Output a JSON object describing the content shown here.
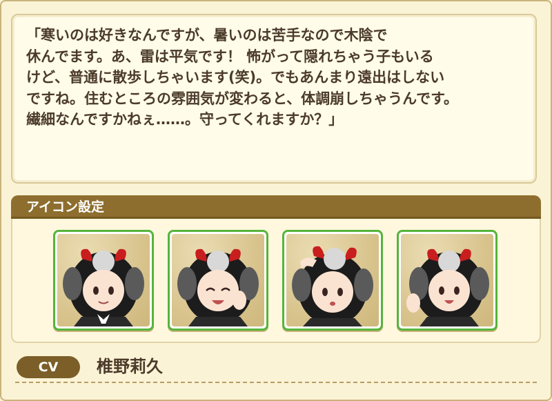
{
  "quote": {
    "lines": [
      "「寒いのは好きなんですが、暑いのは苦手なので木陰で",
      "休んでます。あ、雷は平気です！ 怖がって隠れちゃう子もいる",
      "けど、普通に散歩しちゃいます(笑)。でもあんまり遠出はしない",
      "ですね。住むところの雰囲気が変わると、体調崩しちゃうんです。",
      "繊細なんですかねぇ……。守ってくれますか？」"
    ]
  },
  "icon_section": {
    "title": "アイコン設定",
    "icons": [
      {
        "name": "neutral-smile-portrait"
      },
      {
        "name": "laughing-portrait"
      },
      {
        "name": "salute-surprised-portrait"
      },
      {
        "name": "waving-happy-portrait"
      }
    ]
  },
  "cv": {
    "label": "CV",
    "name": "椎野莉久"
  },
  "colors": {
    "background": "#fbf3d4",
    "header_brown": "#8e6e2e",
    "card_border_green": "#55b43a",
    "text_brown": "#4b3a2a"
  }
}
